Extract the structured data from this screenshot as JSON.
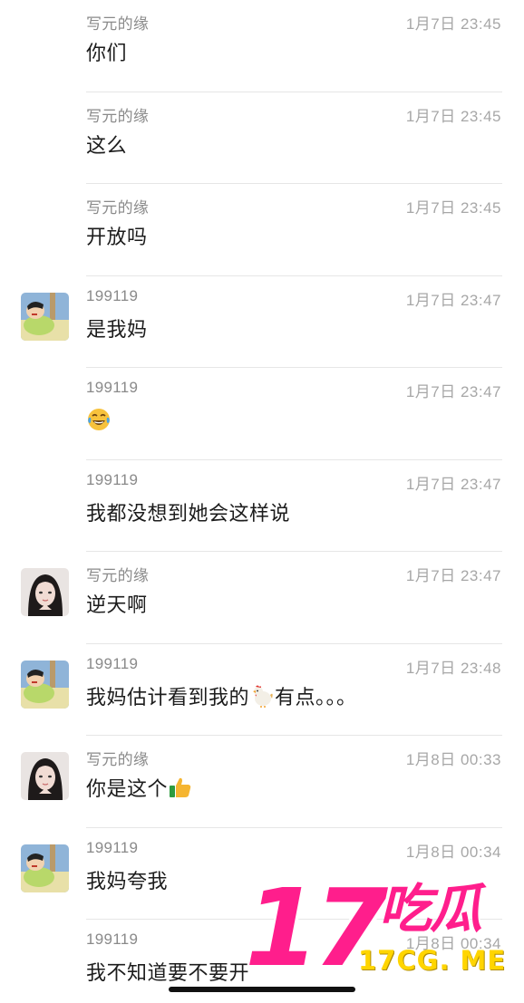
{
  "messages": [
    {
      "sender": "写元的缘",
      "time": "1月7日 23:45",
      "text": "你们",
      "avatar": "",
      "emoji": ""
    },
    {
      "sender": "写元的缘",
      "time": "1月7日 23:45",
      "text": "这么",
      "avatar": "",
      "emoji": ""
    },
    {
      "sender": "写元的缘",
      "time": "1月7日 23:45",
      "text": "开放吗",
      "avatar": "",
      "emoji": ""
    },
    {
      "sender": "199119",
      "time": "1月7日 23:47",
      "text": "是我妈",
      "avatar": "cartoon-boy",
      "emoji": ""
    },
    {
      "sender": "199119",
      "time": "1月7日 23:47",
      "text": "",
      "avatar": "",
      "emoji": "tears-of-joy"
    },
    {
      "sender": "199119",
      "time": "1月7日 23:47",
      "text": "我都没想到她会这样说",
      "avatar": "",
      "emoji": ""
    },
    {
      "sender": "写元的缘",
      "time": "1月7日 23:47",
      "text": "逆天啊",
      "avatar": "girl-photo",
      "emoji": ""
    },
    {
      "sender": "199119",
      "time": "1月7日 23:48",
      "text": "我妈估计看到我的",
      "text_after": "有点。。。",
      "avatar": "cartoon-boy",
      "emoji": "chicken"
    },
    {
      "sender": "写元的缘",
      "time": "1月8日 00:33",
      "text": "你是这个",
      "avatar": "girl-photo",
      "emoji": "thumbs-up"
    },
    {
      "sender": "199119",
      "time": "1月8日 00:34",
      "text": "我妈夸我",
      "avatar": "cartoon-boy",
      "emoji": ""
    },
    {
      "sender": "199119",
      "time": "1月8日 00:34",
      "text": "我不知道要不要开",
      "avatar": "",
      "emoji": ""
    }
  ],
  "watermark": {
    "number": "17",
    "chinese": "吃瓜",
    "url": "17CG. ME"
  },
  "colors": {
    "watermark_pink": "#ff1e8c",
    "watermark_yellow": "#ffd500",
    "separator": "#e6e6e6"
  }
}
